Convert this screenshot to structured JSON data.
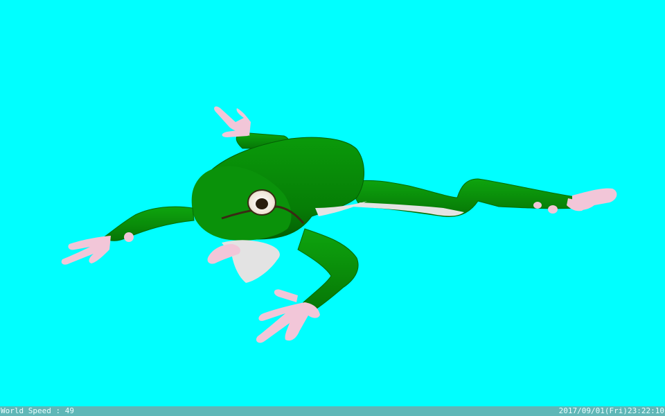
{
  "viewport": {
    "background": "#00ffff",
    "subject": "frog-3d-model"
  },
  "colors": {
    "frog_green": "#0a8f0a",
    "frog_dark_green": "#056b05",
    "belly": "#e3e3e3",
    "toe_pink": "#f2c6d8",
    "status_bar": "#5fb7b7"
  },
  "status_bar": {
    "world_speed_label": "World Speed : ",
    "world_speed_value": "49",
    "datetime": "2017/09/01(Fri)23:22:10"
  }
}
